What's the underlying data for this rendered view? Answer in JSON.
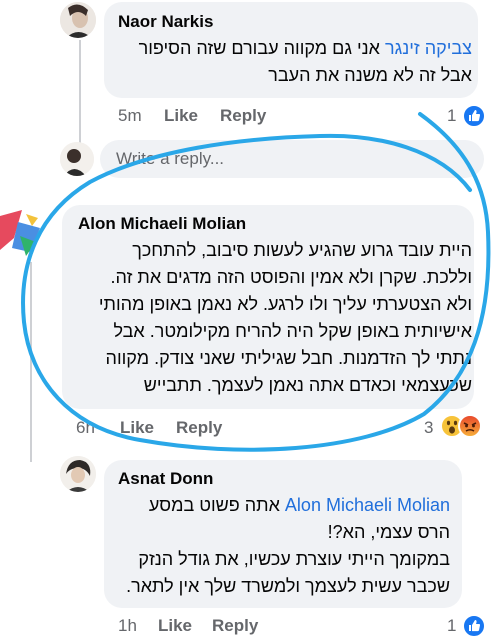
{
  "comments": [
    {
      "author": "Naor Narkis",
      "mention": "צביקה זינגר",
      "line1_rest": " אני גם מקווה עבורם שזה הסיפור",
      "line2": "אבל זה לא משנה את העבר",
      "time": "5m",
      "like_label": "Like",
      "reply_label": "Reply",
      "reaction_count": "1"
    },
    {
      "author": "Alon Michaeli Molian",
      "lines": [
        "היית עובד גרוע שהגיע לעשות סיבוב, להתחכך",
        "וללכת. שקרן ולא אמין והפוסט הזה מדגים את זה.",
        "ולא הצטערתי עליך ולו לרגע. לא נאמן באופן מהותי",
        "אישיותית באופן שקל היה להריח מקילומטר. אבל",
        "נתתי לך הזדמנות. חבל שגיליתי שאני צודק. מקווה",
        "שכעצמאי וכאדם אתה נאמן לעצמך. תתבייש"
      ],
      "time": "6h",
      "like_label": "Like",
      "reply_label": "Reply",
      "reaction_count": "3"
    },
    {
      "author": "Asnat Donn",
      "mention": "Alon Michaeli Molian",
      "line1_rest": " אתה פשוט במסע",
      "lines": [
        "הרס עצמי, הא?!",
        "במקומך הייתי עוצרת עכשיו, את גודל הנזק",
        "שכבר עשית לעצמך ולמשרד שלך אין לתאר."
      ],
      "time": "1h",
      "like_label": "Like",
      "reply_label": "Reply",
      "reaction_count": "1"
    }
  ],
  "reply_input": {
    "placeholder": "Write a reply..."
  },
  "icons": {
    "like_badge": "thumbs-up-icon",
    "wow_reaction": "wow-emoji-icon",
    "angry_reaction": "angry-emoji-icon"
  },
  "colors": {
    "bubble": "#f0f2f5",
    "mention": "#216fdb",
    "like_blue": "#1877f2",
    "annotation": "#2aa7e8",
    "meta": "#65676b"
  }
}
